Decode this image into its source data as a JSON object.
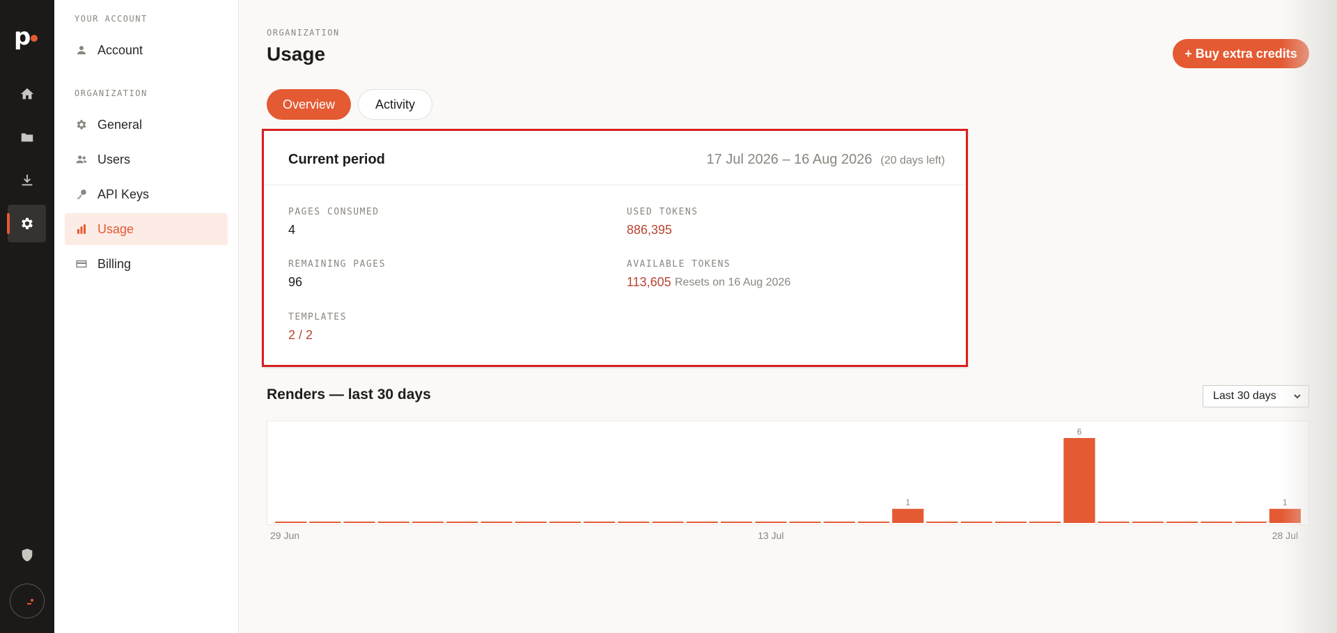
{
  "rail": {
    "logo": "p",
    "items": [
      {
        "name": "home-icon"
      },
      {
        "name": "folder-icon"
      },
      {
        "name": "download-icon"
      },
      {
        "name": "gear-icon"
      }
    ],
    "bottom": [
      {
        "name": "shield-icon"
      },
      {
        "name": "avatar"
      }
    ]
  },
  "sidebar": {
    "your_account_label": "YOUR ACCOUNT",
    "organization_label": "ORGANIZATION",
    "items": [
      {
        "label": "Account",
        "icon": "person-icon"
      },
      {
        "label": "General",
        "icon": "gear-icon"
      },
      {
        "label": "Users",
        "icon": "users-icon"
      },
      {
        "label": "API Keys",
        "icon": "key-icon"
      },
      {
        "label": "Usage",
        "icon": "bar-chart-icon"
      },
      {
        "label": "Billing",
        "icon": "credit-card-icon"
      }
    ]
  },
  "header": {
    "eyebrow": "ORGANIZATION",
    "title": "Usage",
    "buy_button": "+ Buy extra credits"
  },
  "tabs": [
    {
      "label": "Overview",
      "active": true
    },
    {
      "label": "Activity",
      "active": false
    }
  ],
  "period": {
    "title": "Current period",
    "dates": "17 Jul 2026 – 16 Aug 2026",
    "days_left": "(20 days left)",
    "stats": {
      "pages_consumed_label": "PAGES CONSUMED",
      "pages_consumed": "4",
      "used_tokens_label": "USED TOKENS",
      "used_tokens": "886,395",
      "remaining_pages_label": "REMAINING PAGES",
      "remaining_pages": "96",
      "available_tokens_label": "AVAILABLE TOKENS",
      "available_tokens": "113,605",
      "resets_note": "Resets on 16 Aug 2026",
      "templates_label": "TEMPLATES",
      "templates": "2 / 2"
    }
  },
  "renders": {
    "title": "Renders — last 30 days",
    "range_select": "Last 30 days"
  },
  "colors": {
    "accent": "#e45a33",
    "accent_text": "#b84431",
    "rail_bg": "#1b1a18"
  },
  "chart_data": {
    "type": "bar",
    "categories": [
      "29 Jun",
      "30 Jun",
      "1 Jul",
      "2 Jul",
      "3 Jul",
      "4 Jul",
      "5 Jul",
      "6 Jul",
      "7 Jul",
      "8 Jul",
      "9 Jul",
      "10 Jul",
      "11 Jul",
      "12 Jul",
      "13 Jul",
      "14 Jul",
      "15 Jul",
      "16 Jul",
      "17 Jul",
      "18 Jul",
      "19 Jul",
      "20 Jul",
      "21 Jul",
      "22 Jul",
      "23 Jul",
      "24 Jul",
      "25 Jul",
      "26 Jul",
      "27 Jul",
      "28 Jul"
    ],
    "values": [
      0,
      0,
      0,
      0,
      0,
      0,
      0,
      0,
      0,
      0,
      0,
      0,
      0,
      0,
      0,
      0,
      0,
      0,
      1,
      0,
      0,
      0,
      0,
      6,
      0,
      0,
      0,
      0,
      0,
      1
    ],
    "tick_labels": [
      "29 Jun",
      "13 Jul",
      "28 Jul"
    ],
    "ylim": [
      0,
      6
    ],
    "grid": false,
    "data_labels": true
  }
}
